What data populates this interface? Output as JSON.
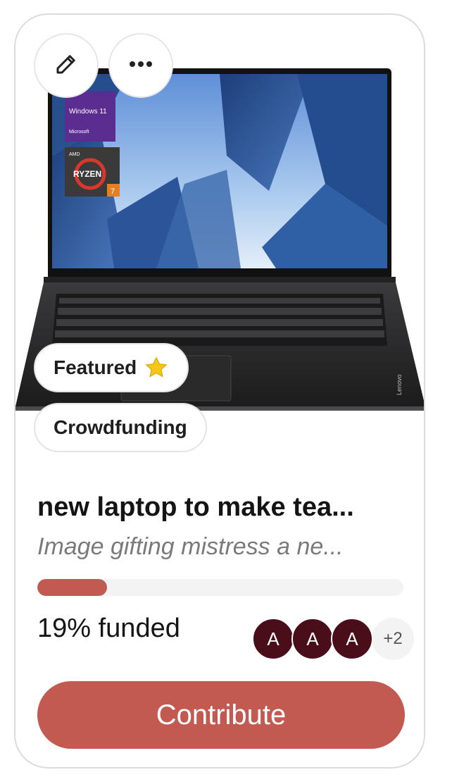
{
  "card": {
    "image": {
      "screen_badge_os": "Windows 11",
      "screen_badge_brand": "Microsoft",
      "cpu_badge_maker": "AMD",
      "cpu_badge_name": "RYZEN",
      "cpu_badge_tier": "7",
      "laptop_brand": "Lenovo"
    },
    "actions": {
      "edit_icon": "pencil-icon",
      "more_icon": "more-horizontal-icon"
    },
    "badges": {
      "featured_label": "Featured",
      "featured_icon": "star-icon",
      "type_label": "Crowdfunding"
    },
    "title": "new laptop to make tea...",
    "subtitle": "Image gifting mistress a ne...",
    "progress": {
      "percent": 19,
      "funded_text": "19% funded",
      "fill_color": "#c25a52"
    },
    "contributors": {
      "avatars": [
        "A",
        "A",
        "A"
      ],
      "more_text": "+2",
      "avatar_color": "#4a0d1a"
    },
    "contribute_label": "Contribute"
  }
}
